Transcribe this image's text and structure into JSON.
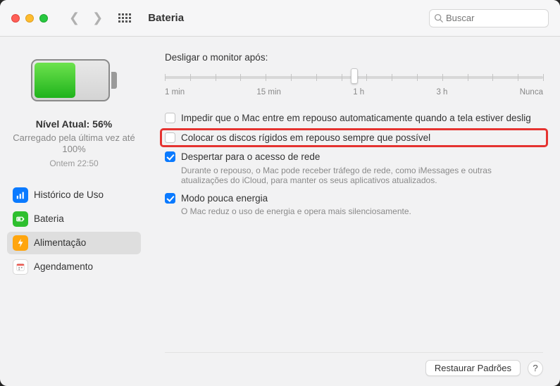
{
  "window": {
    "title": "Bateria"
  },
  "search": {
    "placeholder": "Buscar"
  },
  "battery": {
    "level_label": "Nível Atual: 56%",
    "charged_label": "Carregado pela última vez até 100%",
    "timestamp": "Ontem 22:50"
  },
  "sidebar": {
    "items": [
      {
        "label": "Histórico de Uso",
        "icon": "usage-icon",
        "color": "#0a7aff"
      },
      {
        "label": "Bateria",
        "icon": "battery-icon",
        "color": "#2ebf2e"
      },
      {
        "label": "Alimentação",
        "icon": "power-icon",
        "color": "#ffa50e"
      },
      {
        "label": "Agendamento",
        "icon": "schedule-icon",
        "color": "#ffffff"
      }
    ],
    "active_index": 2
  },
  "slider": {
    "label": "Desligar o monitor após:",
    "ticks": [
      "1 min",
      "15 min",
      "1 h",
      "3 h",
      "Nunca"
    ],
    "value_index": 2
  },
  "options": [
    {
      "checked": false,
      "highlighted": false,
      "label": "Impedir que o Mac entre em repouso automaticamente quando a tela estiver deslig"
    },
    {
      "checked": false,
      "highlighted": true,
      "label": "Colocar os discos rígidos em repouso sempre que possível"
    },
    {
      "checked": true,
      "highlighted": false,
      "label": "Despertar para o acesso de rede",
      "sub": "Durante o repouso, o Mac pode receber tráfego de rede, como iMessages e outras atualizações do iCloud, para manter os seus aplicativos atualizados."
    },
    {
      "checked": true,
      "highlighted": false,
      "label": "Modo pouca energia",
      "sub": "O Mac reduz o uso de energia e opera mais silenciosamente."
    }
  ],
  "footer": {
    "restore": "Restaurar Padrões",
    "help": "?"
  }
}
